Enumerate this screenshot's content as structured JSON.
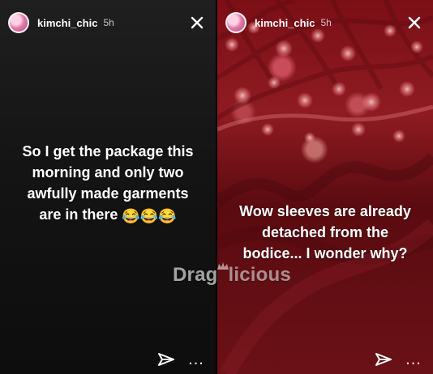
{
  "left_story": {
    "header": {
      "username": "kimchi_chic",
      "time": "5h"
    },
    "text_lines": [
      "So I get the package this",
      "morning and only two",
      "awfully made garments",
      "are in there"
    ],
    "emoji": [
      "😂",
      "😂",
      "😂"
    ],
    "footer": {
      "more_label": "..."
    }
  },
  "right_story": {
    "header": {
      "username": "kimchi_chic",
      "time": "5h"
    },
    "text_lines": [
      "Wow sleeves are already",
      "detached from the",
      "bodice... I wonder why?"
    ],
    "footer": {
      "more_label": "..."
    }
  },
  "watermark": {
    "part1": "Drag",
    "part2": "licious"
  },
  "icons": {
    "avatar": "profile-avatar",
    "close": "close-icon",
    "send": "send-icon",
    "more": "more-icon",
    "watermark_crown": "crown-icon"
  },
  "colors": {
    "left_background": "#141414",
    "right_background": "#7b0f16",
    "text": "#ffffff"
  }
}
